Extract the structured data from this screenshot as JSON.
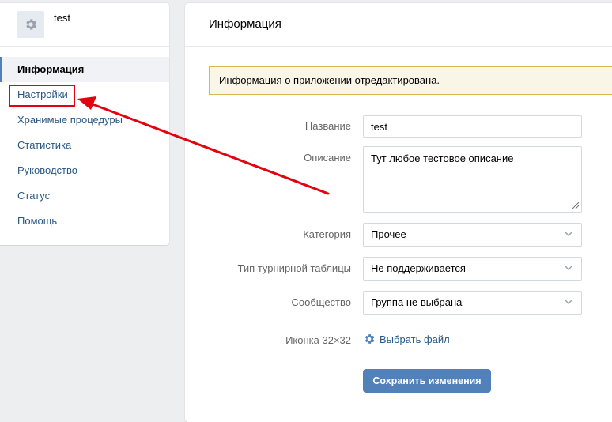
{
  "app": {
    "name": "test",
    "icon": "gear-icon"
  },
  "sidebar": {
    "items": [
      {
        "label": "Информация",
        "active": true
      },
      {
        "label": "Настройки"
      },
      {
        "label": "Хранимые процедуры"
      },
      {
        "label": "Статистика"
      },
      {
        "label": "Руководство"
      },
      {
        "label": "Статус"
      },
      {
        "label": "Помощь"
      }
    ]
  },
  "main": {
    "title": "Информация",
    "notice": "Информация о приложении отредактирована.",
    "form": {
      "name_label": "Название",
      "name_value": "test",
      "description_label": "Описание",
      "description_value": "Тут любое тестовое описание",
      "category_label": "Категория",
      "category_value": "Прочее",
      "leaderboard_label": "Тип турнирной таблицы",
      "leaderboard_value": "Не поддерживается",
      "community_label": "Сообщество",
      "community_value": "Группа не выбрана",
      "icon_label": "Иконка 32×32",
      "choose_file_label": "Выбрать файл",
      "save_label": "Сохранить изменения"
    }
  },
  "colors": {
    "accent": "#5181b8",
    "link": "#2a5885",
    "highlight_red": "#e3000f",
    "notice_bg": "#f9f6e7",
    "notice_border": "#d4bc4c"
  }
}
